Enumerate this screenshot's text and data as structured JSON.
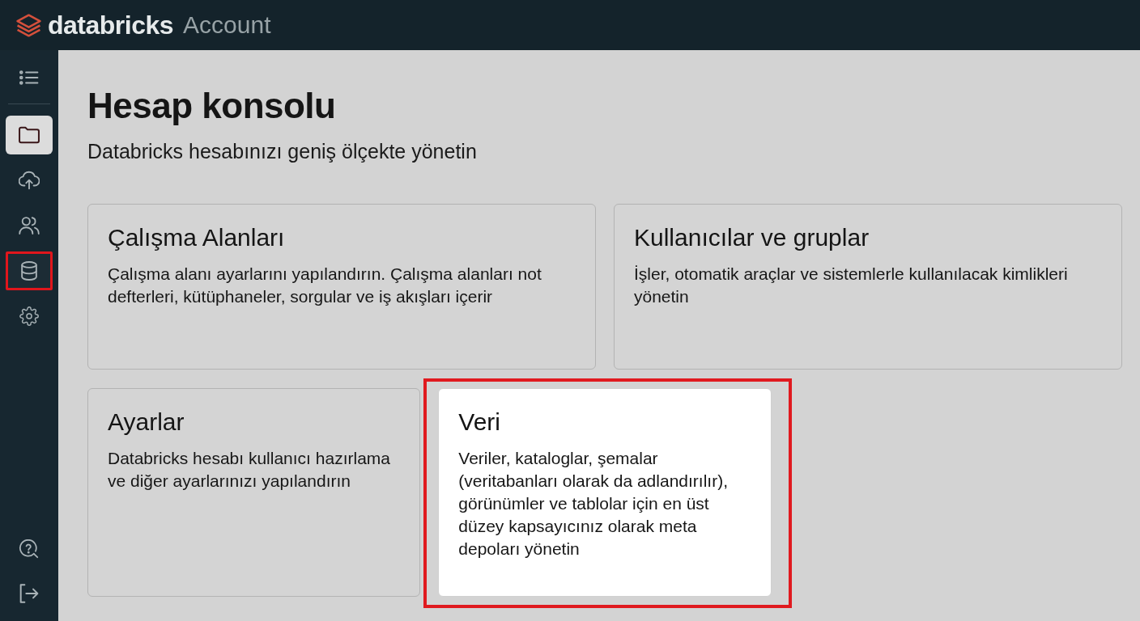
{
  "header": {
    "brand": "databricks",
    "product": "Account"
  },
  "sidebar": {
    "items": [
      {
        "selected": true,
        "highlighted": false
      },
      {
        "selected": false,
        "highlighted": false
      },
      {
        "selected": false,
        "highlighted": false
      },
      {
        "selected": false,
        "highlighted": true
      },
      {
        "selected": false,
        "highlighted": false
      }
    ]
  },
  "page": {
    "title": "Hesap konsolu",
    "subtitle": "Databricks hesabınızı geniş ölçekte yönetin"
  },
  "cards": [
    {
      "title": "Çalışma Alanları",
      "description": "Çalışma alanı ayarlarını yapılandırın. Çalışma alanları not defterleri, kütüphaneler, sorgular ve iş akışları içerir",
      "highlighted": false
    },
    {
      "title": "Kullanıcılar ve gruplar",
      "description": "İşler, otomatik araçlar ve sistemlerle kullanılacak kimlikleri yönetin",
      "highlighted": false
    },
    {
      "title": "Ayarlar",
      "description": "Databricks hesabı kullanıcı hazırlama ve diğer ayarlarınızı yapılandırın",
      "highlighted": false
    },
    {
      "title": "Veri",
      "description": "Veriler, kataloglar, şemalar (veritabanları olarak da adlandırılır), görünümler ve tablolar için en üst düzey kapsayıcınız olarak meta depoları yönetin",
      "highlighted": true
    }
  ]
}
